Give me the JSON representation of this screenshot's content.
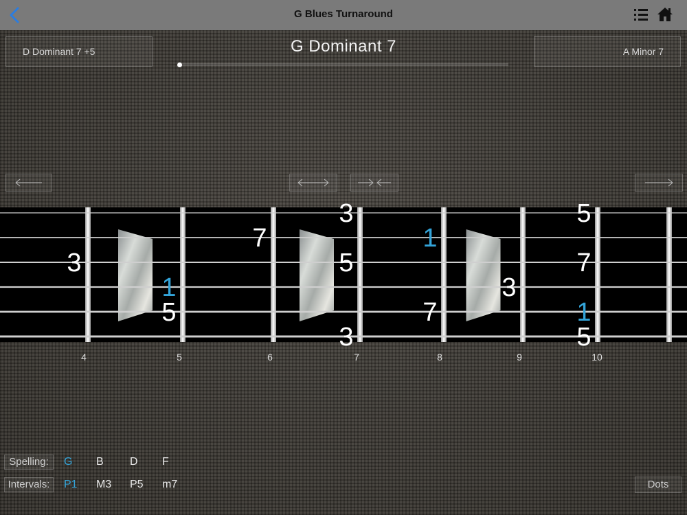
{
  "nav": {
    "title": "G Blues Turnaround",
    "back_icon": "chevron-left-icon",
    "list_icon": "list-icon",
    "home_icon": "home-icon",
    "accent": "#2b7de0"
  },
  "chord": {
    "prev_label": "D  Dominant 7 +5",
    "current_name": "G  Dominant 7",
    "next_label": "A  Minor 7",
    "progress": 0.0
  },
  "arrows": {
    "left": "arrow-left-icon",
    "expand": "arrows-apart-icon",
    "contract": "arrows-together-icon",
    "right": "arrow-right-icon"
  },
  "fretboard": {
    "fret_numbers": [
      "4",
      "5",
      "6",
      "7",
      "8",
      "9",
      "10"
    ],
    "root_color": "#33a4d9",
    "note_color": "#ffffff",
    "notes": [
      {
        "label": "3",
        "string": 2,
        "fret": 4,
        "root": false
      },
      {
        "label": "1",
        "string": 3,
        "fret": 5,
        "root": true
      },
      {
        "label": "5",
        "string": 4,
        "fret": 5,
        "root": false
      },
      {
        "label": "7",
        "string": 1,
        "fret": 6,
        "root": false
      },
      {
        "label": "3",
        "string": 0,
        "fret": 7,
        "root": false
      },
      {
        "label": "5",
        "string": 2,
        "fret": 7,
        "root": false
      },
      {
        "label": "3",
        "string": 5,
        "fret": 7,
        "root": false
      },
      {
        "label": "1",
        "string": 1,
        "fret": 8,
        "root": true
      },
      {
        "label": "7",
        "string": 4,
        "fret": 8,
        "root": false
      },
      {
        "label": "3",
        "string": 3,
        "fret": 9,
        "root": false
      },
      {
        "label": "5",
        "string": 0,
        "fret": 10,
        "root": false
      },
      {
        "label": "7",
        "string": 2,
        "fret": 10,
        "root": false
      },
      {
        "label": "1",
        "string": 4,
        "fret": 10,
        "root": true
      },
      {
        "label": "5",
        "string": 5,
        "fret": 10,
        "root": false
      }
    ],
    "inlays": [
      "4-5",
      "6-7",
      "8-9"
    ]
  },
  "spelling": {
    "label": "Spelling:",
    "notes": [
      "G",
      "B",
      "D",
      "F"
    ]
  },
  "intervals": {
    "label": "Intervals:",
    "values": [
      "P1",
      "M3",
      "P5",
      "m7"
    ]
  },
  "dots_label": "Dots"
}
